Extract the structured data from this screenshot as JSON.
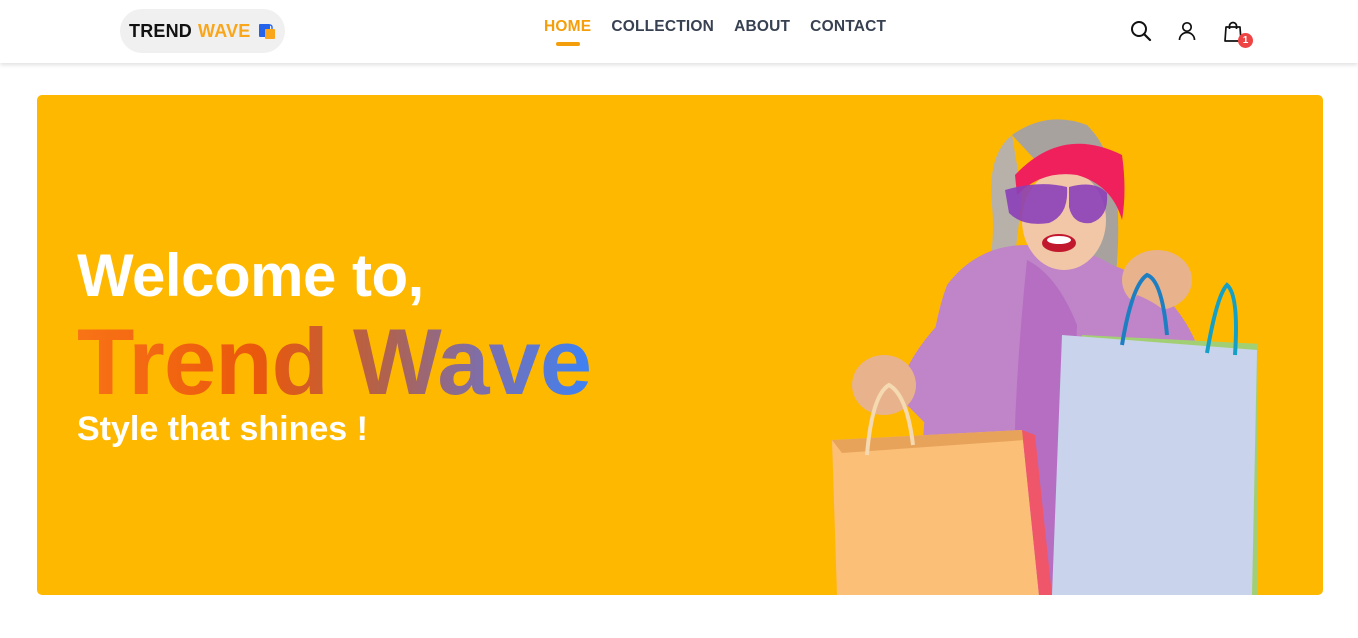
{
  "brand": {
    "word1": "TREND",
    "word2": "WAVE",
    "accent": "#f9a61a"
  },
  "nav": {
    "links": [
      {
        "label": "HOME",
        "active": true
      },
      {
        "label": "COLLECTION",
        "active": false
      },
      {
        "label": "ABOUT",
        "active": false
      },
      {
        "label": "CONTACT",
        "active": false
      }
    ],
    "active_color": "#f59e0b"
  },
  "header_icons": {
    "search": "search-icon",
    "profile": "user-icon",
    "cart": "shopping-bag-icon",
    "cart_count": "1"
  },
  "hero": {
    "welcome": "Welcome to,",
    "title": "Trend Wave",
    "tagline": "Style that shines !",
    "background": "#ffb800",
    "image": "woman-with-shopping-bags"
  }
}
